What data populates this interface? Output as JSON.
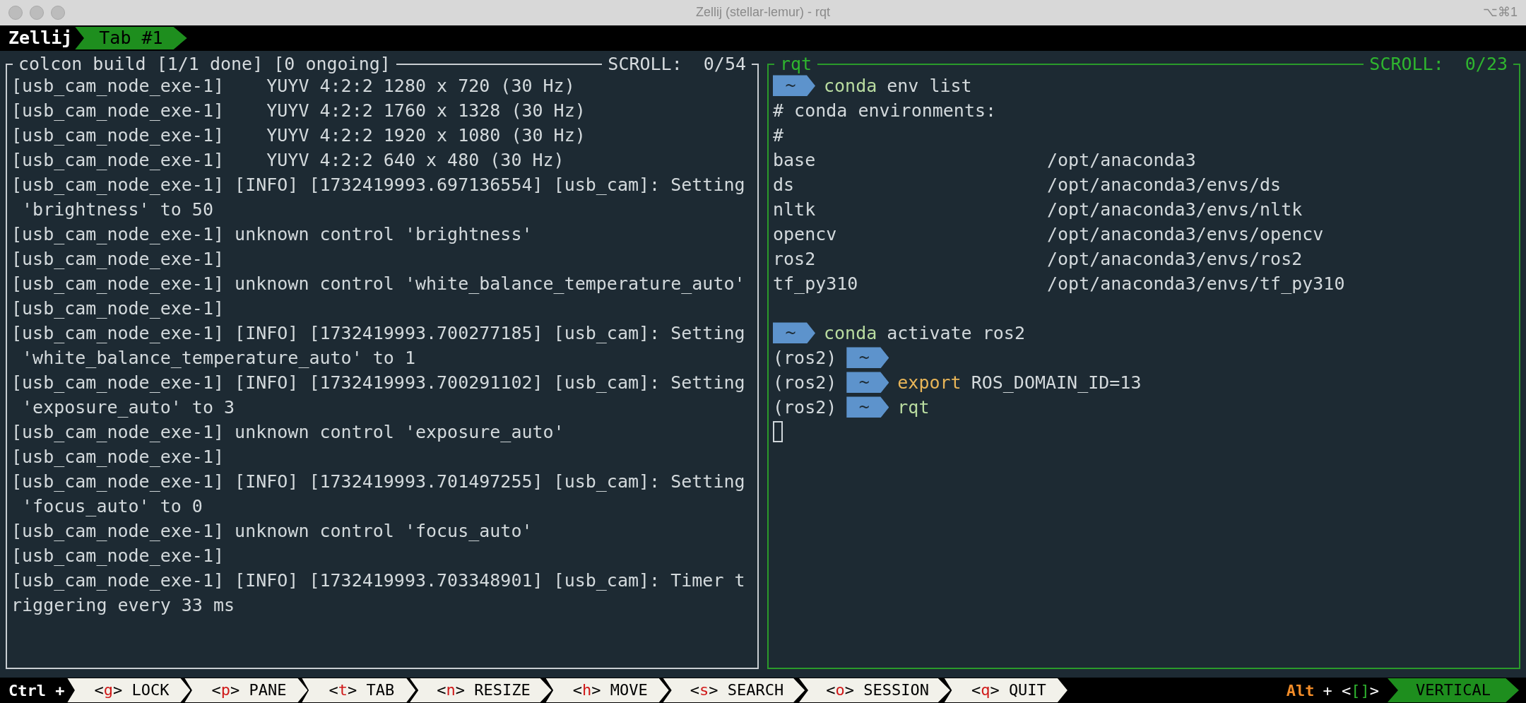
{
  "window": {
    "title": "Zellij (stellar-lemur) - rqt",
    "shortcut": "⌥⌘1"
  },
  "tab_bar": {
    "session": "Zellij",
    "tabs": [
      {
        "label": "Tab #1",
        "selected": true
      }
    ]
  },
  "panes": [
    {
      "title": "colcon build [1/1 done] [0 ongoing]",
      "scroll": "SCROLL:  0/54",
      "focused": false,
      "lines": [
        {
          "kind": "text",
          "text": "[usb_cam_node_exe-1]    YUYV 4:2:2 1280 x 720 (30 Hz)"
        },
        {
          "kind": "text",
          "text": "[usb_cam_node_exe-1]    YUYV 4:2:2 1760 x 1328 (30 Hz)"
        },
        {
          "kind": "text",
          "text": "[usb_cam_node_exe-1]    YUYV 4:2:2 1920 x 1080 (30 Hz)"
        },
        {
          "kind": "text",
          "text": "[usb_cam_node_exe-1]    YUYV 4:2:2 640 x 480 (30 Hz)"
        },
        {
          "kind": "text",
          "text": "[usb_cam_node_exe-1] [INFO] [1732419993.697136554] [usb_cam]: Setting"
        },
        {
          "kind": "text",
          "text": " 'brightness' to 50"
        },
        {
          "kind": "text",
          "text": "[usb_cam_node_exe-1] unknown control 'brightness'"
        },
        {
          "kind": "text",
          "text": "[usb_cam_node_exe-1]"
        },
        {
          "kind": "text",
          "text": "[usb_cam_node_exe-1] unknown control 'white_balance_temperature_auto'"
        },
        {
          "kind": "text",
          "text": "[usb_cam_node_exe-1]"
        },
        {
          "kind": "text",
          "text": "[usb_cam_node_exe-1] [INFO] [1732419993.700277185] [usb_cam]: Setting"
        },
        {
          "kind": "text",
          "text": " 'white_balance_temperature_auto' to 1"
        },
        {
          "kind": "text",
          "text": "[usb_cam_node_exe-1] [INFO] [1732419993.700291102] [usb_cam]: Setting"
        },
        {
          "kind": "text",
          "text": " 'exposure_auto' to 3"
        },
        {
          "kind": "text",
          "text": "[usb_cam_node_exe-1] unknown control 'exposure_auto'"
        },
        {
          "kind": "text",
          "text": "[usb_cam_node_exe-1]"
        },
        {
          "kind": "text",
          "text": "[usb_cam_node_exe-1] [INFO] [1732419993.701497255] [usb_cam]: Setting"
        },
        {
          "kind": "text",
          "text": " 'focus_auto' to 0"
        },
        {
          "kind": "text",
          "text": "[usb_cam_node_exe-1] unknown control 'focus_auto'"
        },
        {
          "kind": "text",
          "text": "[usb_cam_node_exe-1]"
        },
        {
          "kind": "text",
          "text": "[usb_cam_node_exe-1] [INFO] [1732419993.703348901] [usb_cam]: Timer t"
        },
        {
          "kind": "text",
          "text": "riggering every 33 ms"
        }
      ]
    },
    {
      "title": "rqt",
      "scroll": "SCROLL:  0/23",
      "focused": true,
      "lines": [
        {
          "kind": "prompt",
          "dir": "~",
          "command": "conda",
          "color": "#b9dca0",
          "args": "env list"
        },
        {
          "kind": "text",
          "text": "# conda environments:"
        },
        {
          "kind": "text",
          "text": "#"
        },
        {
          "kind": "env",
          "name": "base",
          "path": "/opt/anaconda3"
        },
        {
          "kind": "env",
          "name": "ds",
          "path": "/opt/anaconda3/envs/ds"
        },
        {
          "kind": "env",
          "name": "nltk",
          "path": "/opt/anaconda3/envs/nltk"
        },
        {
          "kind": "env",
          "name": "opencv",
          "path": "/opt/anaconda3/envs/opencv"
        },
        {
          "kind": "env",
          "name": "ros2",
          "path": "/opt/anaconda3/envs/ros2"
        },
        {
          "kind": "env",
          "name": "tf_py310",
          "path": "/opt/anaconda3/envs/tf_py310"
        },
        {
          "kind": "blank"
        },
        {
          "kind": "prompt",
          "dir": "~",
          "command": "conda",
          "color": "#b9dca0",
          "args": "activate ros2"
        },
        {
          "kind": "prompt",
          "venv": "(ros2)",
          "dir": "~"
        },
        {
          "kind": "prompt",
          "venv": "(ros2)",
          "dir": "~",
          "command": "export",
          "color": "#e8b558",
          "args": "ROS_DOMAIN_ID=13"
        },
        {
          "kind": "prompt",
          "venv": "(ros2)",
          "dir": "~",
          "command": "rqt",
          "color": "#b9dca0"
        },
        {
          "kind": "cursor"
        }
      ]
    }
  ],
  "status_bar": {
    "modifier": "Ctrl +",
    "keys": [
      {
        "open": "<",
        "key": "g",
        "close": ">",
        "label": "LOCK"
      },
      {
        "open": "<",
        "key": "p",
        "close": ">",
        "label": "PANE"
      },
      {
        "open": "<",
        "key": "t",
        "close": ">",
        "label": "TAB"
      },
      {
        "open": "<",
        "key": "n",
        "close": ">",
        "label": "RESIZE"
      },
      {
        "open": "<",
        "key": "h",
        "close": ">",
        "label": "MOVE"
      },
      {
        "open": "<",
        "key": "s",
        "close": ">",
        "label": "SEARCH"
      },
      {
        "open": "<",
        "key": "o",
        "close": ">",
        "label": "SESSION"
      },
      {
        "open": "<",
        "key": "q",
        "close": ">",
        "label": "QUIT"
      }
    ],
    "alt": "Alt",
    "alt_plus": "+",
    "alt_open": "<",
    "alt_key": "[]",
    "alt_close": ">",
    "modes": [
      {
        "label": "VERTICAL",
        "selected": true
      }
    ]
  }
}
